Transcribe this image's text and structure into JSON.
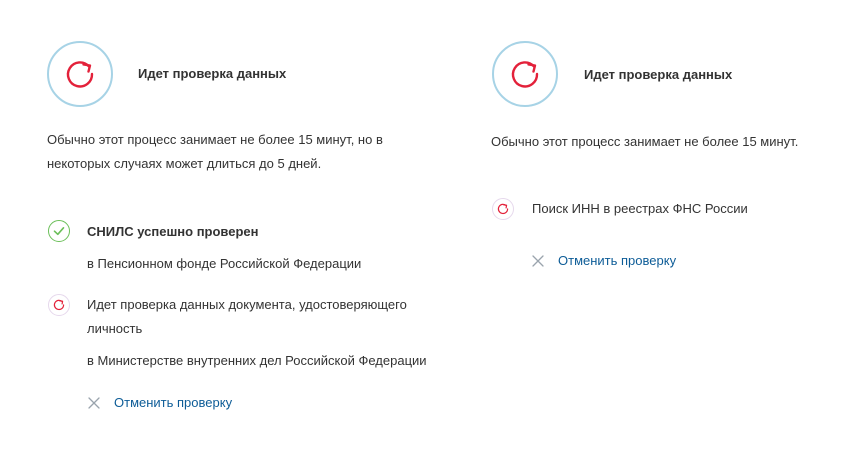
{
  "left": {
    "title": "Идет проверка данных",
    "description": "Обычно этот процесс занимает не более 15 минут, но в некоторых случаях может длиться до 5 дней.",
    "steps": [
      {
        "status": "success",
        "title": "СНИЛС успешно проверен",
        "detail": "в Пенсионном фонде Российской Федерации"
      },
      {
        "status": "in-progress",
        "title": "Идет проверка данных документа, удостоверяющего личность",
        "detail": "в Министерстве внутренних дел Российской Федерации"
      }
    ],
    "cancel_label": "Отменить проверку"
  },
  "right": {
    "title": "Идет проверка данных",
    "description": "Обычно этот процесс занимает не более 15 минут.",
    "steps": [
      {
        "status": "in-progress",
        "title": "Поиск ИНН в реестрах ФНС России"
      }
    ],
    "cancel_label": "Отменить проверку"
  },
  "colors": {
    "accent_red": "#e3213a",
    "circle_border": "#a7d3e6",
    "success_green": "#6bbf59",
    "link_blue": "#0d5c97"
  },
  "icons": {
    "status": "refresh-icon",
    "success": "check-icon",
    "pending": "refresh-icon",
    "cancel": "close-icon"
  }
}
